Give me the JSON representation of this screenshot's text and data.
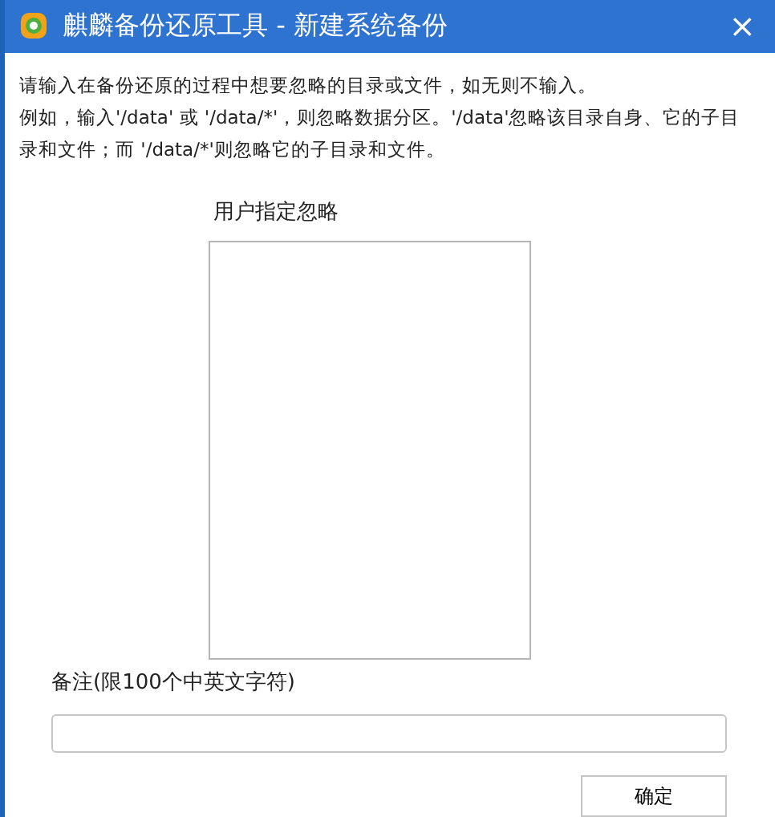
{
  "window": {
    "title": "麒麟备份还原工具 - 新建系统备份",
    "close": "×"
  },
  "instructions": [
    "请输入在备份还原的过程中想要忽略的目录或文件，如无则不输入。",
    "例如，输入'/data' 或 '/data/*'，则忽略数据分区。'/data'忽略该目录自身、它的子目录和文件；而 '/data/*'则忽略它的子目录和文件。"
  ],
  "ignore_list": {
    "label": "用户指定忽略"
  },
  "note": {
    "label": "备注(限100个中英文字符)"
  },
  "buttons": [
    "确定"
  ]
}
